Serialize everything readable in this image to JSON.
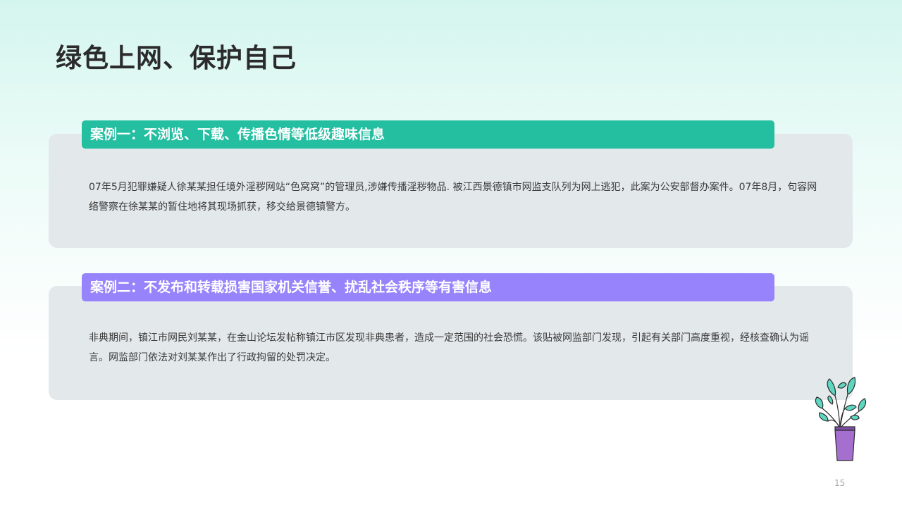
{
  "slide": {
    "title": "绿色上网、保护自己",
    "page_number": "15"
  },
  "cases": [
    {
      "header": "案例一：不浏览、下载、传播色情等低级趣味信息",
      "body": "07年5月犯罪嫌疑人徐某某担任境外淫秽网站“色窝窝”的管理员,涉嫌传播淫秽物品. 被江西景德镇市网监支队列为网上逃犯，此案为公安部督办案件。07年8月，句容网络警察在徐某某的暂住地将其现场抓获，移交给景德镇警方。",
      "header_color": "#24bea0"
    },
    {
      "header": "案例二：不发布和转载损害国家机关信誉、扰乱社会秩序等有害信息",
      "body": "非典期间，镇江市网民刘某某，在金山论坛发帖称镇江市区发现非典患者，造成一定范围的社会恐慌。该贴被网监部门发现，引起有关部门高度重视，经核查确认为谣言。网监部门依法对刘某某作出了行政拘留的处罚决定。",
      "header_color": "#9783fb"
    }
  ],
  "decoration": {
    "icon": "potted-plant-icon",
    "pot_color": "#a56fd0",
    "leaf_color": "#5fd6c0"
  }
}
